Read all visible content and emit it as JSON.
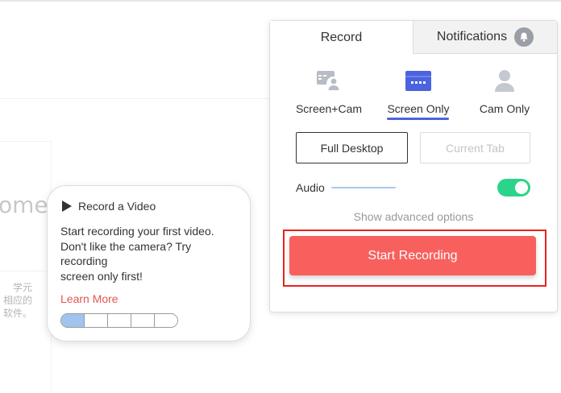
{
  "background": {
    "partial_word": "ome",
    "partial_cn_lines": [
      "学元",
      "相应的",
      "软件。"
    ]
  },
  "tooltip": {
    "title": "Record a Video",
    "body_lines": [
      "Start recording your first video.",
      "Don't like the camera? Try",
      "recording",
      "screen only first!"
    ],
    "link": "Learn More",
    "progress": {
      "total_steps": 5,
      "current_step": 1
    }
  },
  "panel": {
    "tabs": [
      {
        "label": "Record",
        "active": true
      },
      {
        "label": "Notifications",
        "active": false,
        "icon": "bell-icon"
      }
    ],
    "modes": [
      {
        "label": "Screen+Cam",
        "icon": "screen-cam-icon",
        "selected": false
      },
      {
        "label": "Screen Only",
        "icon": "screen-only-icon",
        "selected": true
      },
      {
        "label": "Cam Only",
        "icon": "cam-only-icon",
        "selected": false
      }
    ],
    "capture": {
      "full_desktop": "Full Desktop",
      "current_tab": "Current Tab"
    },
    "audio": {
      "label": "Audio",
      "enabled": true
    },
    "advanced": "Show advanced options",
    "start": "Start Recording"
  },
  "colors": {
    "accent_blue": "#4b63e0",
    "toggle_green": "#2bd48a",
    "start_red": "#f8605e",
    "highlight_red": "#e5231f",
    "link_red": "#e5544e"
  }
}
